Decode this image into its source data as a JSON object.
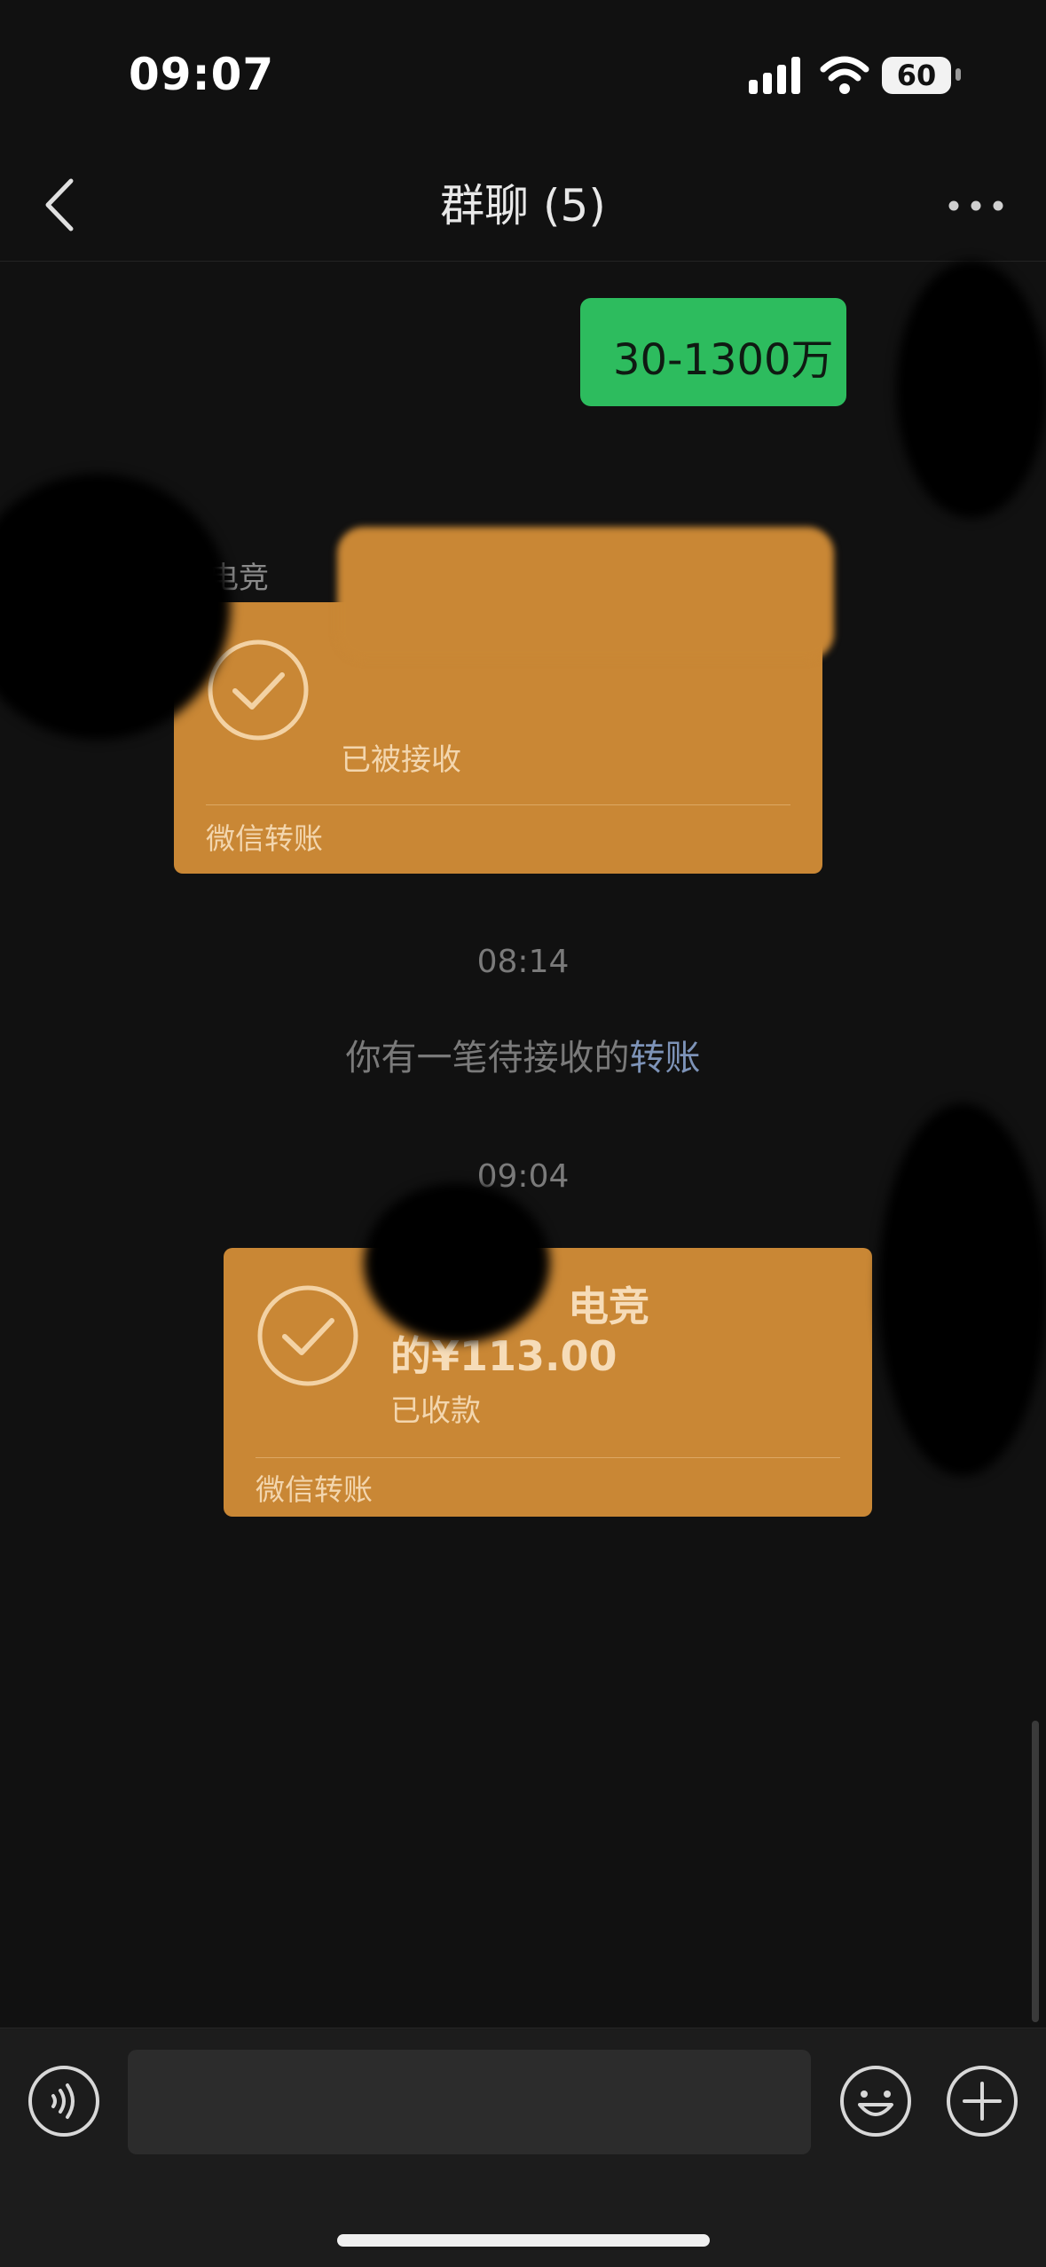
{
  "status_bar": {
    "time": "09:07",
    "battery_level": "60",
    "icons": [
      "signal-icon",
      "wifi-icon",
      "battery-icon"
    ]
  },
  "nav": {
    "title": "群聊 (5)",
    "back_icon": "chevron-left-icon",
    "more_icon": "more-dots-icon"
  },
  "messages": {
    "outgoing_text": "30-1300万",
    "sender_name_partial": "电竞",
    "transfer_1": {
      "status": "已被接收",
      "footer": "微信转账"
    },
    "time_1": "08:14",
    "system_prefix": "你有一笔待接收的",
    "system_link": "转账",
    "time_2": "09:04",
    "transfer_2": {
      "title_line1": "电竞",
      "title_line2": "的¥113.00",
      "status": "已收款",
      "footer": "微信转账"
    }
  },
  "input_bar": {
    "voice_icon": "voice-icon",
    "emoji_icon": "emoji-icon",
    "plus_icon": "plus-icon",
    "placeholder": ""
  },
  "colors": {
    "background": "#111111",
    "bubble_out": "#2dbc5e",
    "transfer_card": "#c98735",
    "link": "#7d93b8"
  }
}
